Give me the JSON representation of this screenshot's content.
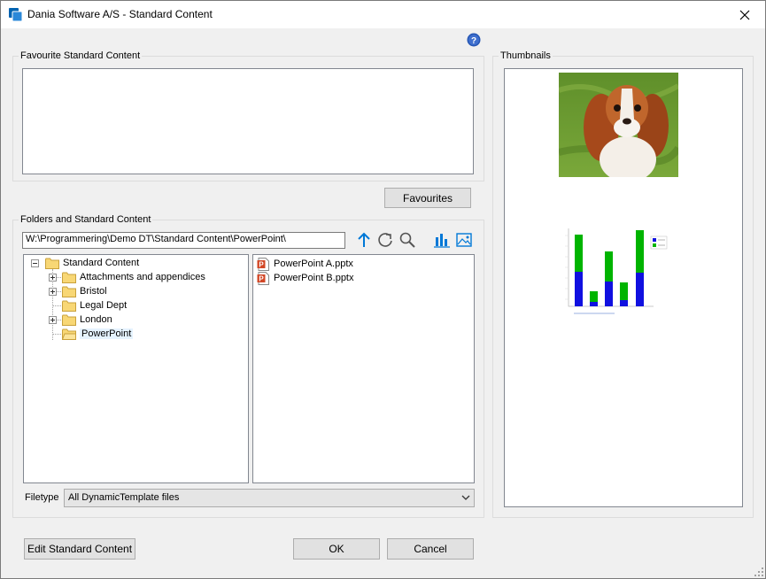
{
  "window": {
    "title": "Dania Software A/S - Standard Content"
  },
  "favourites_group": {
    "legend": "Favourite Standard Content",
    "button_label": "Favourites"
  },
  "folders_group": {
    "legend": "Folders and Standard Content",
    "path": "W:\\Programmering\\Demo DT\\Standard Content\\PowerPoint\\",
    "tree": {
      "root": "Standard Content",
      "children": [
        {
          "label": "Attachments and appendices",
          "expandable": true
        },
        {
          "label": "Bristol",
          "expandable": true
        },
        {
          "label": "Legal Dept",
          "expandable": false
        },
        {
          "label": "London",
          "expandable": true
        },
        {
          "label": "PowerPoint",
          "expandable": false,
          "selected": true
        }
      ]
    },
    "files": [
      "PowerPoint A.pptx",
      "PowerPoint B.pptx"
    ],
    "filetype_label": "Filetype",
    "filetype_value": "All DynamicTemplate files"
  },
  "thumbnails_group": {
    "legend": "Thumbnails"
  },
  "buttons": {
    "edit": "Edit Standard Content",
    "ok": "OK",
    "cancel": "Cancel"
  },
  "colors": {
    "accent": "#0078d7",
    "folder": "#f8d775",
    "selection": "#e5f3ff",
    "chart_green": "#00b400",
    "chart_blue": "#1010e0"
  }
}
